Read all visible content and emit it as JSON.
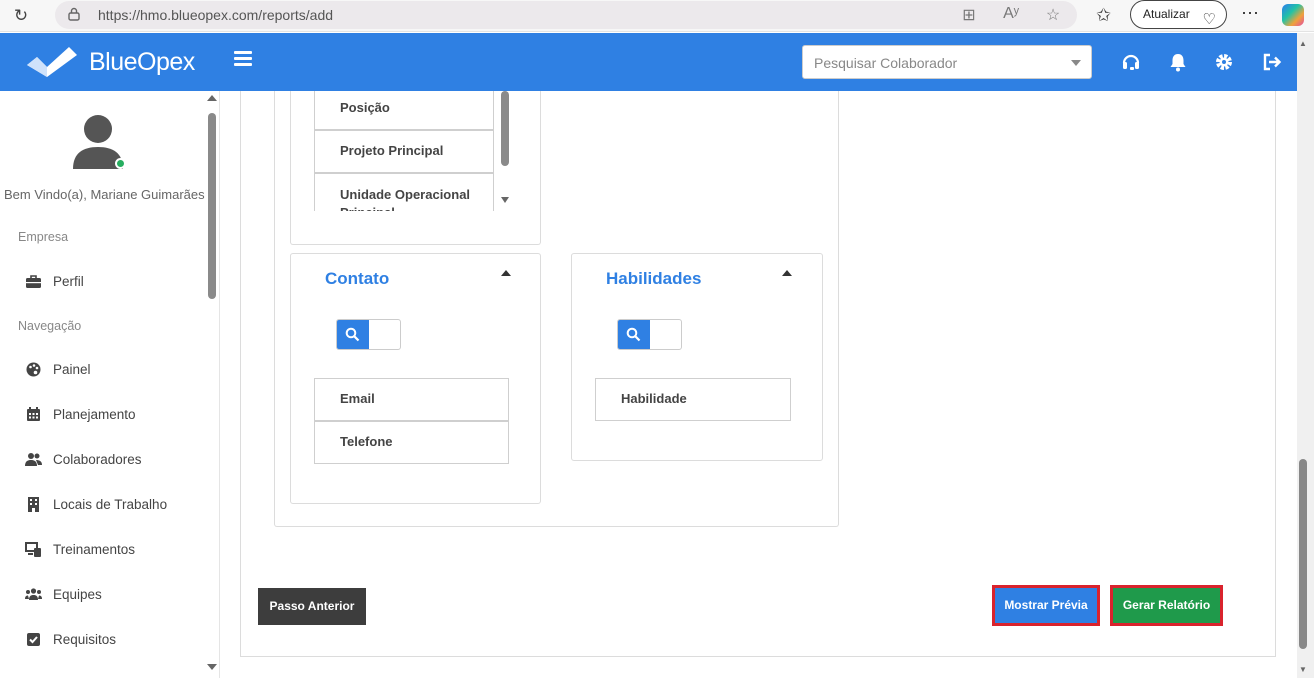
{
  "browser": {
    "url": "https://hmo.blueopex.com/reports/add",
    "update_label": "Atualizar"
  },
  "header": {
    "brand": "BlueOpex",
    "search_placeholder": "Pesquisar Colaborador",
    "accent_color": "#2f80e3"
  },
  "sidebar": {
    "welcome": "Bem Vindo(a), Mariane Guimarães",
    "section_company": "Empresa",
    "profile": "Perfil",
    "section_nav": "Navegação",
    "items": [
      {
        "label": "Painel",
        "icon": "palette-icon"
      },
      {
        "label": "Planejamento",
        "icon": "calendar-icon"
      },
      {
        "label": "Colaboradores",
        "icon": "users-icon"
      },
      {
        "label": "Locais de Trabalho",
        "icon": "building-icon"
      },
      {
        "label": "Treinamentos",
        "icon": "devices-icon"
      },
      {
        "label": "Equipes",
        "icon": "team-icon"
      },
      {
        "label": "Requisitos",
        "icon": "checkbox-icon"
      }
    ]
  },
  "panels": {
    "top_list": [
      "Posição",
      "Projeto Principal",
      "Unidade Operacional Principal"
    ],
    "contato": {
      "title": "Contato",
      "fields": [
        "Email",
        "Telefone"
      ]
    },
    "habilidades": {
      "title": "Habilidades",
      "fields": [
        "Habilidade"
      ]
    }
  },
  "actions": {
    "previous": "Passo Anterior",
    "preview": "Mostrar Prévia",
    "generate": "Gerar Relatório"
  }
}
